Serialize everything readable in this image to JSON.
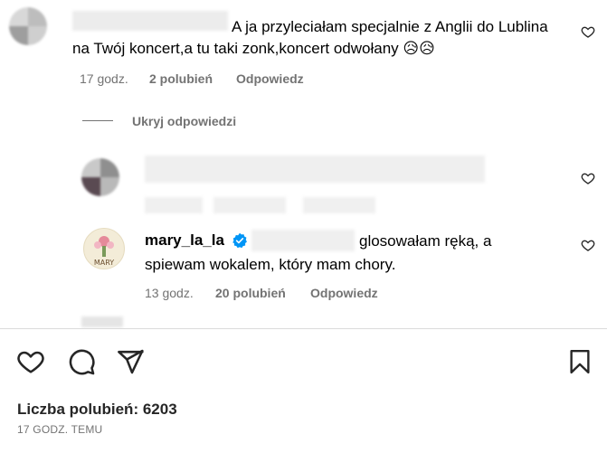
{
  "comment": {
    "text": "A ja przyleciałam specjalnie z Anglii do Lublina na Twój koncert,a tu taki zonk,koncert odwołany 😥😥",
    "time": "17 godz.",
    "likes": "2 polubień",
    "reply": "Odpowiedz"
  },
  "hide_replies": "Ukryj odpowiedzi",
  "reply2": {
    "username": "mary_la_la",
    "verified_icon": "verified-badge-icon",
    "text_line1": "glosowałam ręką, a",
    "text_line2": "spiewam wokalem, który mam chory.",
    "time": "13 godz.",
    "likes": "20 polubień",
    "reply": "Odpowiedz"
  },
  "post": {
    "likes_label": "Liczba polubień: 6203",
    "time": "17 GODZ. TEMU"
  },
  "icons": [
    "heart-icon",
    "comment-icon",
    "share-icon",
    "bookmark-icon"
  ]
}
